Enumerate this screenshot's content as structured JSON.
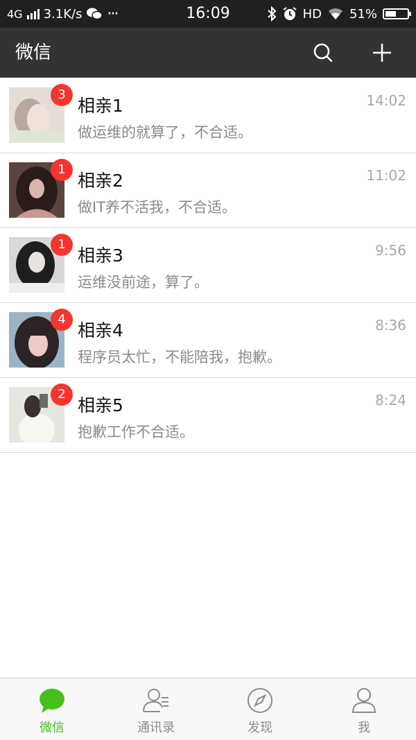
{
  "status_bar": {
    "network": "4G",
    "speed": "3.1K/s",
    "dots": "···",
    "time": "16:09",
    "hd": "HD",
    "battery": "51%",
    "battery_level": 0.51,
    "icons": [
      "signal-icon",
      "wechat-notification-icon",
      "bluetooth-icon",
      "alarm-icon",
      "wifi-icon",
      "battery-icon"
    ]
  },
  "header": {
    "title": "微信",
    "icons": [
      "search-icon",
      "plus-icon"
    ]
  },
  "chats": [
    {
      "name": "相亲1",
      "time": "14:02",
      "preview": "做运维的就算了，不合适。",
      "badge": "3"
    },
    {
      "name": "相亲2",
      "time": "11:02",
      "preview": "做IT养不活我，不合适。",
      "badge": "1"
    },
    {
      "name": "相亲3",
      "time": "9:56",
      "preview": "运维没前途，算了。",
      "badge": "1"
    },
    {
      "name": "相亲4",
      "time": "8:36",
      "preview": "程序员太忙，不能陪我，抱歉。",
      "badge": "4"
    },
    {
      "name": "相亲5",
      "time": "8:24",
      "preview": "抱歉工作不合适。",
      "badge": "2"
    }
  ],
  "tabs": [
    {
      "label": "微信",
      "icon": "chat-bubble-icon",
      "active": true
    },
    {
      "label": "通讯录",
      "icon": "contacts-icon",
      "active": false
    },
    {
      "label": "发现",
      "icon": "compass-icon",
      "active": false
    },
    {
      "label": "我",
      "icon": "person-icon",
      "active": false
    }
  ],
  "colors": {
    "header_bg": "#333333",
    "status_bg": "#202020",
    "badge": "#f43530",
    "accent_green": "#45c01a",
    "tab_inactive": "#8a8a8a"
  }
}
